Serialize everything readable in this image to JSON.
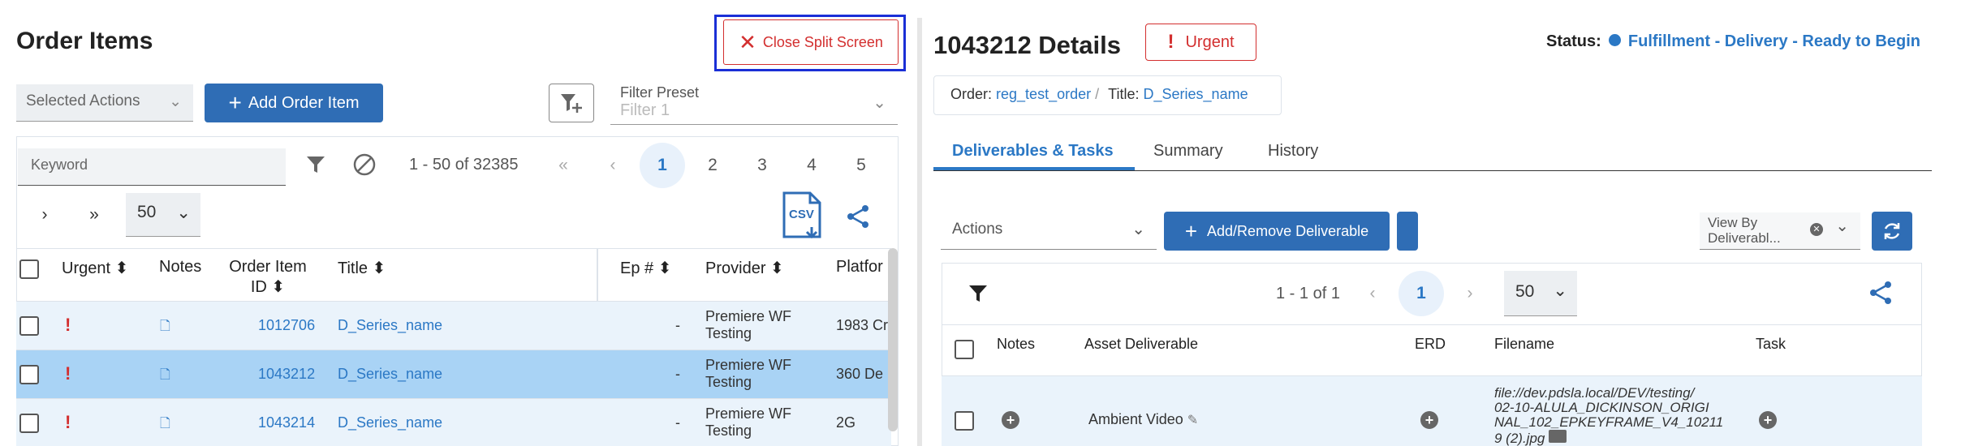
{
  "left": {
    "title": "Order Items",
    "close_split": "Close Split Screen",
    "selected_actions": "Selected Actions",
    "add_order_item": "Add Order Item",
    "filter_preset_label": "Filter Preset",
    "filter_preset_placeholder": "Filter 1",
    "keyword_placeholder": "Keyword",
    "range": "1 - 50 of 32385",
    "pages": [
      "1",
      "2",
      "3",
      "4",
      "5"
    ],
    "first": "«",
    "prev": "‹",
    "next": "›",
    "last": "»",
    "page_size": "50",
    "csv": "CSV",
    "columns": {
      "urgent": "Urgent",
      "notes": "Notes",
      "order_item_id_1": "Order Item",
      "order_item_id_2": "ID",
      "title": "Title",
      "ep": "Ep #",
      "provider": "Provider",
      "platform": "Platfor"
    },
    "rows": [
      {
        "urgent": "!",
        "id": "1012706",
        "title": "D_Series_name",
        "ep": "-",
        "provider1": "Premiere WF",
        "provider2": "Testing",
        "platform": "1983 Cr"
      },
      {
        "urgent": "!",
        "id": "1043212",
        "title": "D_Series_name",
        "ep": "-",
        "provider1": "Premiere WF",
        "provider2": "Testing",
        "platform": "360 De"
      },
      {
        "urgent": "!",
        "id": "1043214",
        "title": "D_Series_name",
        "ep": "-",
        "provider1": "Premiere WF",
        "provider2": "Testing",
        "platform": "2G"
      }
    ]
  },
  "right": {
    "title": "1043212 Details",
    "urgent_badge": "Urgent",
    "status_label": "Status:",
    "status_value": "Fulfillment - Delivery - Ready to Begin",
    "order_label": "Order:",
    "order_value": "reg_test_order",
    "title_label": "Title:",
    "title_value": "D_Series_name",
    "tabs": [
      "Deliverables & Tasks",
      "Summary",
      "History"
    ],
    "actions": "Actions",
    "add_remove": "Add/Remove Deliverable",
    "view_by_1": "View By",
    "view_by_2": "Deliverabl...",
    "range": "1 - 1 of 1",
    "page": "1",
    "prev": "‹",
    "next": "›",
    "page_size": "50",
    "columns": {
      "notes": "Notes",
      "asset": "Asset Deliverable",
      "erd": "ERD",
      "filename": "Filename",
      "task": "Task"
    },
    "row": {
      "asset": "Ambient Video",
      "file1": "file://dev.pdsla.local/DEV/testing/",
      "file2": "02-10-ALULA_DICKINSON_ORIGI",
      "file3": "NAL_102_EPKEYFRAME_V4_10211",
      "file4": "9 (2).jpg"
    }
  },
  "colors": {
    "accent": "#2b78c5",
    "urgent": "#d32f2f",
    "selected_row": "#a9d3f5",
    "alt_row": "#eaf3fb"
  }
}
